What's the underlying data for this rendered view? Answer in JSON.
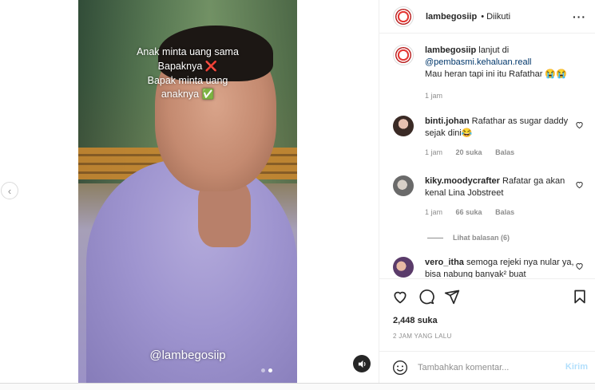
{
  "post": {
    "caption_lines": [
      "Anak minta uang sama",
      "Bapaknya ❌",
      "Bapak minta uang",
      "anaknya ✅"
    ],
    "watermark": "@lambegosiip"
  },
  "header": {
    "username": "lambegosiip",
    "follow_status": "• Diikuti",
    "more": "···"
  },
  "caption_comment": {
    "username": "lambegosiip",
    "text_before": "lanjut di",
    "mention": "@pembasmi.kehaluan.reall",
    "text_after": "Mau heran tapi ini itu Rafathar 😭😭",
    "time": "1 jam"
  },
  "comments": [
    {
      "username": "binti.johan",
      "text": "Rafathar as sugar daddy sejak dini😂",
      "time": "1 jam",
      "likes": "20 suka",
      "reply": "Balas"
    },
    {
      "username": "kiky.moodycrafter",
      "text": "Rafatar ga akan kenal Lina Jobstreet",
      "time": "1 jam",
      "likes": "66 suka",
      "reply": "Balas",
      "view_replies": "Lihat balasan (6)"
    },
    {
      "username": "vero_itha",
      "text": "semoga rejeki nya nular ya, bisa nabung banyak² buat",
      "time": "",
      "likes": "",
      "reply": ""
    }
  ],
  "stats": {
    "likes": "2,448 suka",
    "posted": "2 JAM YANG LALU"
  },
  "add_comment": {
    "placeholder": "Tambahkan komentar...",
    "post_label": "Kirim"
  },
  "colors": {
    "link": "#00376b",
    "muted": "#8e8e8e",
    "post_button_disabled": "#b2dffc"
  },
  "icons": [
    "chevron-left-icon",
    "sound-icon",
    "more-icon",
    "heart-icon",
    "comment-icon",
    "share-icon",
    "bookmark-icon",
    "emoji-icon"
  ]
}
